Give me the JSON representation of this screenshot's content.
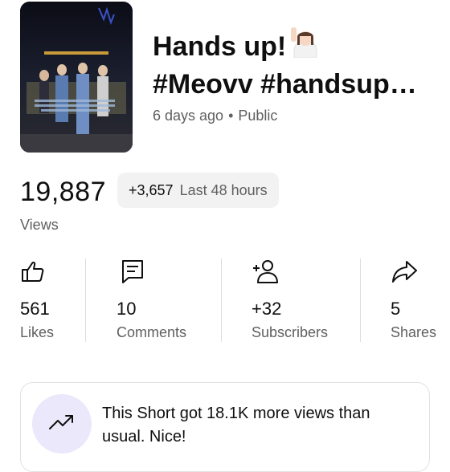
{
  "video": {
    "title_line1": "Hands up!",
    "title_line2": "#Meovv #handsup…",
    "age": "6 days ago",
    "separator": "•",
    "visibility": "Public",
    "emoji": "raising-hand-emoji"
  },
  "views": {
    "count": "19,887",
    "delta": "+3,657",
    "period": "Last 48 hours",
    "label": "Views"
  },
  "stats": [
    {
      "icon": "thumbs-up-icon",
      "value": "561",
      "label": "Likes"
    },
    {
      "icon": "comment-icon",
      "value": "10",
      "label": "Comments"
    },
    {
      "icon": "add-person-icon",
      "value": "+32",
      "label": "Subscribers"
    },
    {
      "icon": "share-icon",
      "value": "5",
      "label": "Shares"
    }
  ],
  "insight": {
    "icon": "trending-up-icon",
    "text": "This Short got 18.1K more views than usual. Nice!",
    "badge_color": "#ece8fb"
  },
  "colors": {
    "primary_text": "#0f0f0f",
    "secondary_text": "#606060",
    "chip_background": "#f2f2f2"
  }
}
